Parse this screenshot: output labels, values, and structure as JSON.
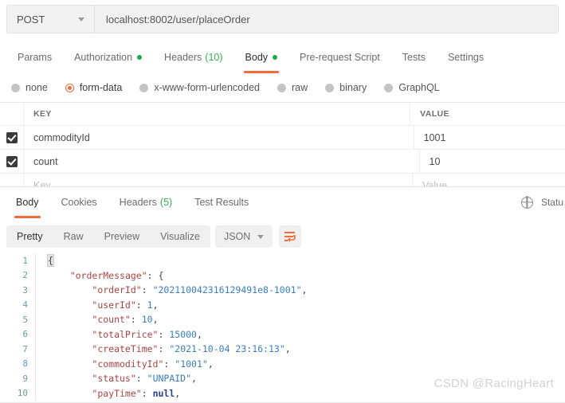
{
  "request": {
    "method": "POST",
    "url": "localhost:8002/user/placeOrder",
    "tabs": [
      {
        "label": "Params",
        "dot": false,
        "count": null,
        "active": false
      },
      {
        "label": "Authorization",
        "dot": true,
        "count": null,
        "active": false
      },
      {
        "label": "Headers",
        "dot": false,
        "count": "(10)",
        "active": false
      },
      {
        "label": "Body",
        "dot": true,
        "count": null,
        "active": true
      },
      {
        "label": "Pre-request Script",
        "dot": false,
        "count": null,
        "active": false
      },
      {
        "label": "Tests",
        "dot": false,
        "count": null,
        "active": false
      },
      {
        "label": "Settings",
        "dot": false,
        "count": null,
        "active": false
      }
    ],
    "body_types": [
      {
        "label": "none",
        "selected": false
      },
      {
        "label": "form-data",
        "selected": true
      },
      {
        "label": "x-www-form-urlencoded",
        "selected": false
      },
      {
        "label": "raw",
        "selected": false
      },
      {
        "label": "binary",
        "selected": false
      },
      {
        "label": "GraphQL",
        "selected": false
      }
    ],
    "table": {
      "headers": {
        "key": "KEY",
        "value": "VALUE"
      },
      "rows": [
        {
          "checked": true,
          "key": "commodityId",
          "value": "1001"
        },
        {
          "checked": true,
          "key": "count",
          "value": "10"
        }
      ],
      "placeholder": {
        "key": "Key",
        "value": "Value"
      }
    }
  },
  "response": {
    "tabs": [
      {
        "label": "Body",
        "count": null,
        "active": true
      },
      {
        "label": "Cookies",
        "count": null,
        "active": false
      },
      {
        "label": "Headers",
        "count": "(5)",
        "active": false
      },
      {
        "label": "Test Results",
        "count": null,
        "active": false
      }
    ],
    "status_label": "Statu",
    "format_tabs": [
      {
        "label": "Pretty",
        "active": true
      },
      {
        "label": "Raw",
        "active": false
      },
      {
        "label": "Preview",
        "active": false
      },
      {
        "label": "Visualize",
        "active": false
      }
    ],
    "language": "JSON",
    "code_lines": [
      {
        "num": "1",
        "indent": 0,
        "tokens": [
          {
            "t": "{",
            "c": "brace-hl"
          }
        ]
      },
      {
        "num": "2",
        "indent": 1,
        "tokens": [
          {
            "t": "\"orderMessage\"",
            "c": "k"
          },
          {
            "t": ": {",
            "c": "p"
          }
        ]
      },
      {
        "num": "3",
        "indent": 2,
        "tokens": [
          {
            "t": "\"orderId\"",
            "c": "k"
          },
          {
            "t": ": ",
            "c": "p"
          },
          {
            "t": "\"202110042316129491e8-1001\"",
            "c": "s"
          },
          {
            "t": ",",
            "c": "p"
          }
        ]
      },
      {
        "num": "4",
        "indent": 2,
        "tokens": [
          {
            "t": "\"userId\"",
            "c": "k"
          },
          {
            "t": ": ",
            "c": "p"
          },
          {
            "t": "1",
            "c": "n"
          },
          {
            "t": ",",
            "c": "p"
          }
        ]
      },
      {
        "num": "5",
        "indent": 2,
        "tokens": [
          {
            "t": "\"count\"",
            "c": "k"
          },
          {
            "t": ": ",
            "c": "p"
          },
          {
            "t": "10",
            "c": "n"
          },
          {
            "t": ",",
            "c": "p"
          }
        ]
      },
      {
        "num": "6",
        "indent": 2,
        "tokens": [
          {
            "t": "\"totalPrice\"",
            "c": "k"
          },
          {
            "t": ": ",
            "c": "p"
          },
          {
            "t": "15000",
            "c": "n"
          },
          {
            "t": ",",
            "c": "p"
          }
        ]
      },
      {
        "num": "7",
        "indent": 2,
        "tokens": [
          {
            "t": "\"createTime\"",
            "c": "k"
          },
          {
            "t": ": ",
            "c": "p"
          },
          {
            "t": "\"2021-10-04 23:16:13\"",
            "c": "s"
          },
          {
            "t": ",",
            "c": "p"
          }
        ]
      },
      {
        "num": "8",
        "indent": 2,
        "tokens": [
          {
            "t": "\"commodityId\"",
            "c": "k"
          },
          {
            "t": ": ",
            "c": "p"
          },
          {
            "t": "\"1001\"",
            "c": "s"
          },
          {
            "t": ",",
            "c": "p"
          }
        ]
      },
      {
        "num": "9",
        "indent": 2,
        "tokens": [
          {
            "t": "\"status\"",
            "c": "k"
          },
          {
            "t": ": ",
            "c": "p"
          },
          {
            "t": "\"UNPAID\"",
            "c": "s"
          },
          {
            "t": ",",
            "c": "p"
          }
        ]
      },
      {
        "num": "10",
        "indent": 2,
        "tokens": [
          {
            "t": "\"payTime\"",
            "c": "k"
          },
          {
            "t": ": ",
            "c": "p"
          },
          {
            "t": "null",
            "c": "nul"
          },
          {
            "t": ",",
            "c": "p"
          }
        ]
      }
    ]
  },
  "watermark": "CSDN @RacingHeart",
  "colors": {
    "accent_orange": "#f26b3a",
    "green_dot": "#1aa84a",
    "count_green": "#35b14c",
    "json_key": "#a94442",
    "json_string": "#3a7ec1",
    "json_null": "#25418e",
    "gutter": "#6a9aa8"
  }
}
